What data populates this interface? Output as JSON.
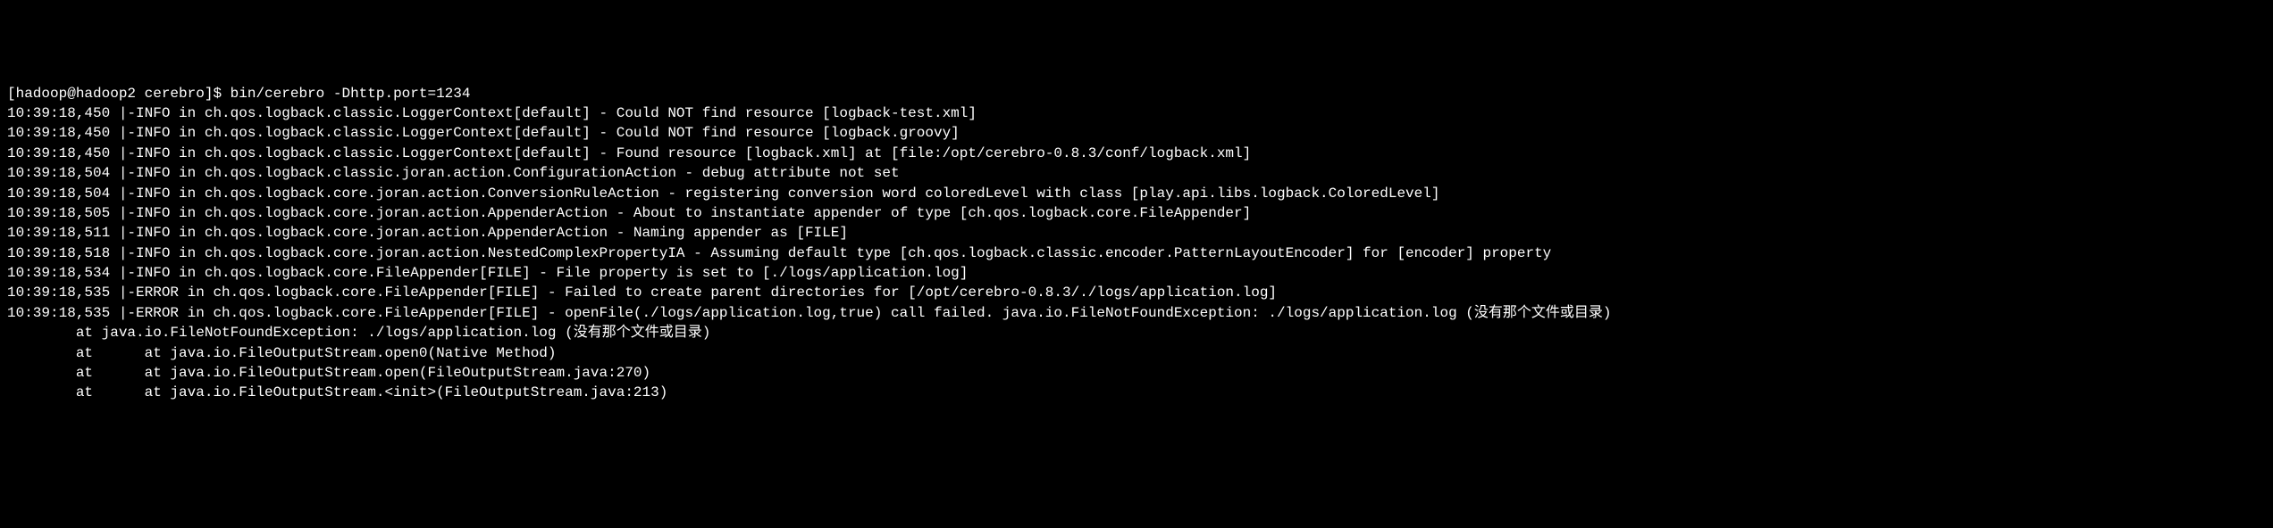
{
  "terminal": {
    "prompt": "[hadoop@hadoop2 cerebro]$ ",
    "command": "bin/cerebro -Dhttp.port=1234",
    "lines": [
      "10:39:18,450 |-INFO in ch.qos.logback.classic.LoggerContext[default] - Could NOT find resource [logback-test.xml]",
      "10:39:18,450 |-INFO in ch.qos.logback.classic.LoggerContext[default] - Could NOT find resource [logback.groovy]",
      "10:39:18,450 |-INFO in ch.qos.logback.classic.LoggerContext[default] - Found resource [logback.xml] at [file:/opt/cerebro-0.8.3/conf/logback.xml]",
      "10:39:18,504 |-INFO in ch.qos.logback.classic.joran.action.ConfigurationAction - debug attribute not set",
      "10:39:18,504 |-INFO in ch.qos.logback.core.joran.action.ConversionRuleAction - registering conversion word coloredLevel with class [play.api.libs.logback.ColoredLevel]",
      "10:39:18,505 |-INFO in ch.qos.logback.core.joran.action.AppenderAction - About to instantiate appender of type [ch.qos.logback.core.FileAppender]",
      "10:39:18,511 |-INFO in ch.qos.logback.core.joran.action.AppenderAction - Naming appender as [FILE]",
      "10:39:18,518 |-INFO in ch.qos.logback.core.joran.action.NestedComplexPropertyIA - Assuming default type [ch.qos.logback.classic.encoder.PatternLayoutEncoder] for [encoder] property",
      "10:39:18,534 |-INFO in ch.qos.logback.core.FileAppender[FILE] - File property is set to [./logs/application.log]",
      "10:39:18,535 |-ERROR in ch.qos.logback.core.FileAppender[FILE] - Failed to create parent directories for [/opt/cerebro-0.8.3/./logs/application.log]",
      "10:39:18,535 |-ERROR in ch.qos.logback.core.FileAppender[FILE] - openFile(./logs/application.log,true) call failed. java.io.FileNotFoundException: ./logs/application.log (没有那个文件或目录)",
      "        at java.io.FileNotFoundException: ./logs/application.log (没有那个文件或目录)",
      "        at      at java.io.FileOutputStream.open0(Native Method)",
      "        at      at java.io.FileOutputStream.open(FileOutputStream.java:270)",
      "        at      at java.io.FileOutputStream.<init>(FileOutputStream.java:213)"
    ]
  }
}
